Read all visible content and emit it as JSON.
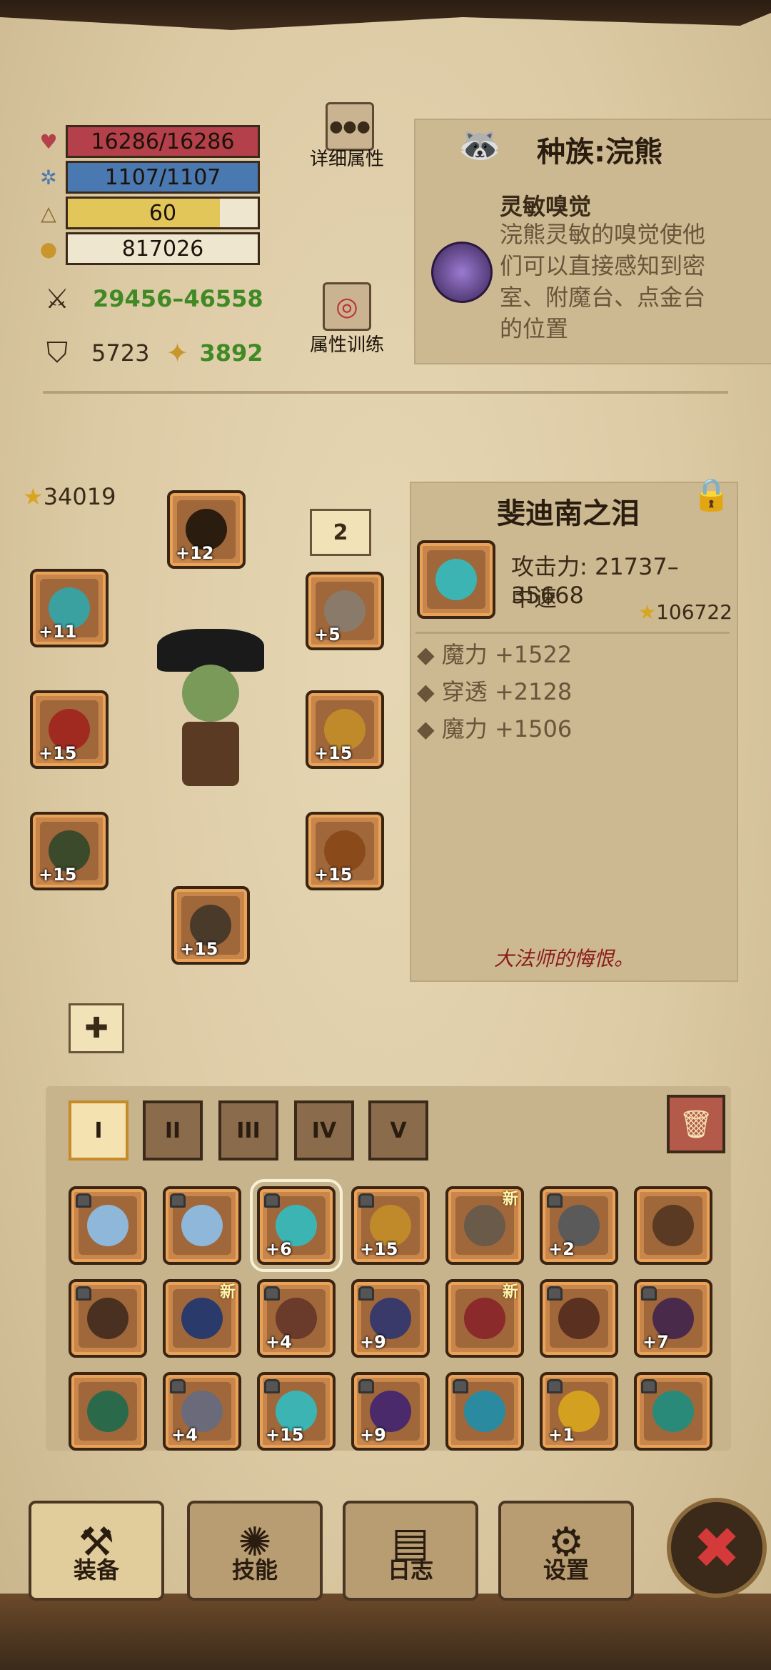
{
  "stats": {
    "hp": "16286/16286",
    "mp": "1107/1107",
    "level": "60",
    "gold": "817026",
    "attack": "29456–46558",
    "defense": "5723",
    "agility": "3892",
    "level_fill": 0.8
  },
  "buttons": {
    "details": "详细属性",
    "training": "属性训练"
  },
  "race": {
    "title": "种族:浣熊",
    "trait_name": "灵敏嗅觉",
    "trait_desc": "浣熊灵敏的嗅觉使他们可以直接感知到密室、附魔台、点金台的位置"
  },
  "character": {
    "power": "34019",
    "equip_levels": [
      "+12",
      "+11",
      "+5",
      "+15",
      "+15",
      "+15",
      "+15",
      "+15"
    ],
    "page_badge": "2"
  },
  "item": {
    "name": "斐迪南之泪",
    "attack": "攻击力: 21737–35668",
    "speed": "中速",
    "score": "106722",
    "bonuses": [
      "魔力 +1522",
      "穿透 +2128",
      "魔力 +1506"
    ],
    "flavor": "大法师的悔恨。"
  },
  "inventory": {
    "tabs": [
      "I",
      "II",
      "III",
      "IV",
      "V"
    ],
    "active_tab": 0,
    "new_label": "新",
    "rows": [
      [
        {
          "lvl": "",
          "lock": true,
          "new": false,
          "color": "#8fb7d9"
        },
        {
          "lvl": "",
          "lock": true,
          "new": false,
          "color": "#8fb7d9"
        },
        {
          "lvl": "+6",
          "lock": true,
          "new": false,
          "color": "#3cb4b4",
          "selected": true
        },
        {
          "lvl": "+15",
          "lock": true,
          "new": false,
          "color": "#c08a2a"
        },
        {
          "lvl": "",
          "lock": false,
          "new": true,
          "color": "#6a5a4a"
        },
        {
          "lvl": "+2",
          "lock": true,
          "new": false,
          "color": "#5a5a5a"
        },
        {
          "lvl": "",
          "lock": false,
          "new": false,
          "color": "#5a3a22"
        }
      ],
      [
        {
          "lvl": "",
          "lock": true,
          "new": false,
          "color": "#4a3020"
        },
        {
          "lvl": "",
          "lock": false,
          "new": true,
          "color": "#2a3a6a"
        },
        {
          "lvl": "+4",
          "lock": true,
          "new": false,
          "color": "#6a3a2a"
        },
        {
          "lvl": "+9",
          "lock": true,
          "new": false,
          "color": "#3a3a6a"
        },
        {
          "lvl": "",
          "lock": false,
          "new": true,
          "color": "#8a2a2a"
        },
        {
          "lvl": "",
          "lock": true,
          "new": false,
          "color": "#5a3020"
        },
        {
          "lvl": "+7",
          "lock": true,
          "new": false,
          "color": "#4a2a4a"
        }
      ],
      [
        {
          "lvl": "",
          "lock": false,
          "new": false,
          "color": "#2a6a4a"
        },
        {
          "lvl": "+4",
          "lock": true,
          "new": false,
          "color": "#6a6a7a"
        },
        {
          "lvl": "+15",
          "lock": true,
          "new": false,
          "color": "#3cb4b4"
        },
        {
          "lvl": "+9",
          "lock": true,
          "new": false,
          "color": "#4a2a6a"
        },
        {
          "lvl": "",
          "lock": true,
          "new": false,
          "color": "#2a8aa0"
        },
        {
          "lvl": "+1",
          "lock": true,
          "new": false,
          "color": "#d4a020"
        },
        {
          "lvl": "",
          "lock": true,
          "new": false,
          "color": "#2a8a7a"
        }
      ]
    ]
  },
  "nav": {
    "equip": "装备",
    "skills": "技能",
    "log": "日志",
    "settings": "设置"
  },
  "colors": {
    "hp": "#b3404a",
    "mp": "#4a78b0",
    "level": "#e3c65a",
    "accent": "#3f8a24"
  }
}
